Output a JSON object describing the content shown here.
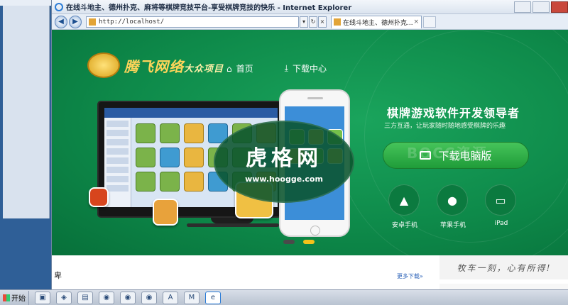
{
  "browser": {
    "title": "在线斗地主、德州扑克、麻将等棋牌竞技平台-享受棋牌竞技的快乐 - Internet Explorer",
    "address": "http://localhost/",
    "tab_title": "在线斗地主、德州扑克..."
  },
  "site": {
    "logo_text": "腾飞网络",
    "logo_sub": "大众项目",
    "nav": [
      {
        "label": "首页",
        "icon": "home-icon"
      },
      {
        "label": "下载中心",
        "icon": "download-icon"
      }
    ],
    "headline": "棋牌游戏软件开发领导者",
    "subline": "三方互通，让玩家随时随地感受棋牌的乐趣",
    "download_pc_label": "下载电脑版",
    "faint_watermark": "BOCC资源",
    "platforms": [
      {
        "label": "安卓手机",
        "icon": "android-icon"
      },
      {
        "label": "苹果手机",
        "icon": "apple-icon"
      },
      {
        "label": "iPad",
        "icon": "ipad-icon"
      }
    ],
    "more_downloads": "更多下载»",
    "calligraphy": "牧车一刻，心有所得!",
    "footer_char": "卑"
  },
  "watermark": {
    "title": "虎格网",
    "url": "www.hoogge.com"
  },
  "taskbar": {
    "start_label": "开始",
    "icons": [
      "server-manager-icon",
      "network-icon",
      "folder-icon",
      "media-icon-1",
      "media-icon-2",
      "media-icon-3",
      "app-icon-a",
      "app-icon-m",
      "ie-icon"
    ]
  },
  "colors": {
    "hero_green": "#0e8a4a",
    "button_green": "#1f9c39",
    "logo_gold": "#ffd55a",
    "active_dot": "#f4c21a"
  }
}
